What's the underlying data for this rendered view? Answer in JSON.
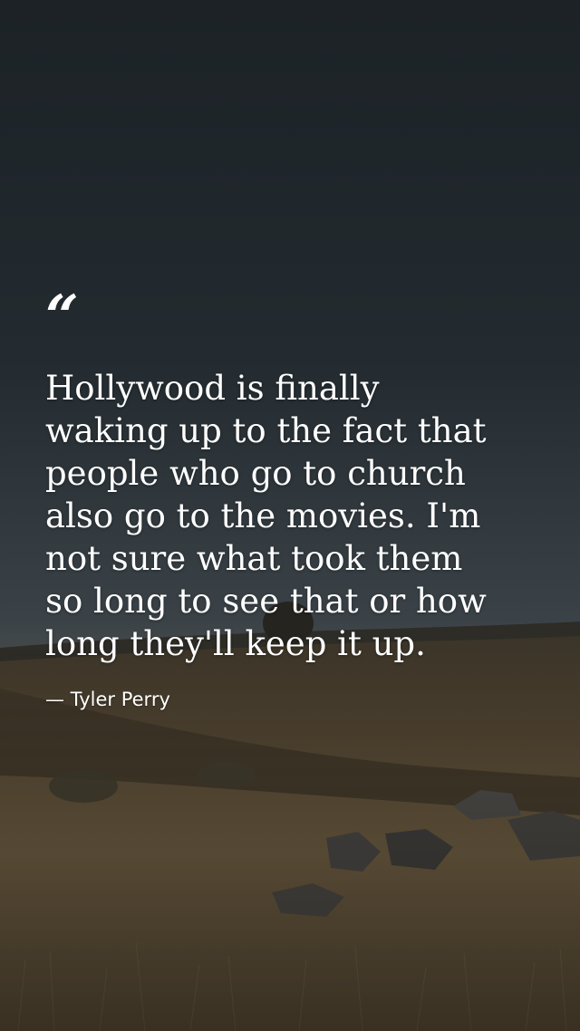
{
  "quote": {
    "mark": "“",
    "text": "Hollywood is finally\nwaking up to the fact that\npeople who go to church\nalso go to the movies. I'm\nnot sure what took them\nso long to see that or how\nlong they'll keep it up.",
    "author": "— Tyler Perry"
  },
  "colors": {
    "sky": "#1f2529",
    "grass": "#5a4a33",
    "text": "#ffffff"
  }
}
